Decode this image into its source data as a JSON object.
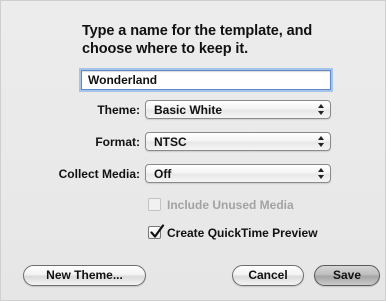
{
  "dialog": {
    "message": "Type a name for the template, and\nchoose where to keep it.",
    "name_value": "Wonderland"
  },
  "fields": {
    "theme": {
      "label": "Theme:",
      "value": "Basic White"
    },
    "format": {
      "label": "Format:",
      "value": "NTSC"
    },
    "collect_media": {
      "label": "Collect Media:",
      "value": "Off"
    }
  },
  "options": {
    "include_unused_media": {
      "label": "Include Unused Media",
      "checked": false,
      "enabled": false
    },
    "create_quicktime_preview": {
      "label": "Create QuickTime Preview",
      "checked": true,
      "enabled": true
    }
  },
  "buttons": {
    "new_theme": "New Theme...",
    "cancel": "Cancel",
    "save": "Save"
  },
  "icons": {
    "popup": "up-down-arrows-icon",
    "check": "checkmark-icon"
  }
}
